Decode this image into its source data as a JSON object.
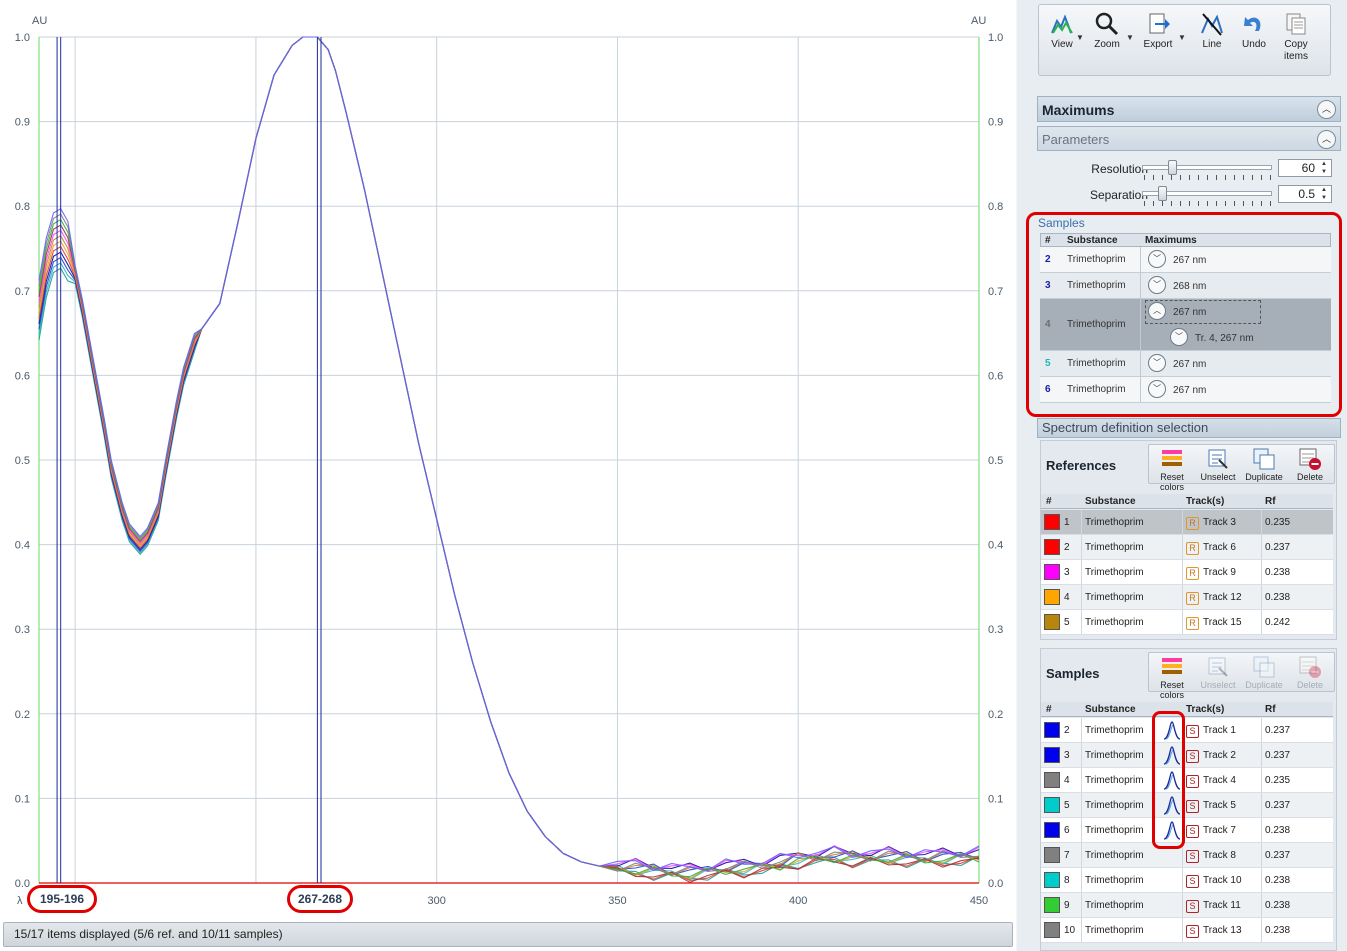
{
  "chart": {
    "y_unit_left": "AU",
    "y_unit_right": "AU",
    "x_axis_symbol": "λ",
    "y_ticks": [
      "0.0",
      "0.1",
      "0.2",
      "0.3",
      "0.4",
      "0.5",
      "0.6",
      "0.7",
      "0.8",
      "0.9",
      "1.0"
    ],
    "x_ticks": [
      "300",
      "350",
      "400",
      "450"
    ],
    "markers": [
      {
        "label": "195-196",
        "x_start": 195,
        "x_end": 196
      },
      {
        "label": "267-268",
        "x_start": 267,
        "x_end": 268
      }
    ],
    "colors": {
      "spectra": [
        "#1f9e8f",
        "#2cb5c4",
        "#2040d8",
        "#1010a0",
        "#e03b3b",
        "#e8a020",
        "#c08a30",
        "#ff40ff",
        "#a03030",
        "#30b040",
        "#808080",
        "#6060ff"
      ],
      "marker_line": "#1a2a9a",
      "axis_green": "#66dd66",
      "baseline_red": "#e00000",
      "grid": "#c8d2dc"
    }
  },
  "chart_data": {
    "type": "line",
    "title": "",
    "xlabel": "λ",
    "ylabel": "AU",
    "xlim": [
      190,
      450
    ],
    "ylim": [
      0,
      1.0
    ],
    "grid": true,
    "series": [
      {
        "x": [
          190,
          192,
          194,
          196,
          198,
          200,
          202,
          205,
          208,
          210,
          213,
          215,
          218,
          220,
          223,
          225,
          228,
          230,
          233,
          235,
          240,
          245,
          250,
          255,
          260,
          263,
          265,
          267,
          270,
          272,
          275,
          280,
          285,
          290,
          295,
          300,
          305,
          310,
          315,
          320,
          325,
          330,
          335,
          340,
          345,
          350,
          355,
          360,
          365,
          370,
          375,
          380,
          385,
          390,
          395,
          400,
          405,
          410,
          415,
          420,
          425,
          430,
          435,
          440,
          445,
          450
        ],
        "y": [
          0.68,
          0.73,
          0.76,
          0.765,
          0.75,
          0.72,
          0.68,
          0.61,
          0.54,
          0.49,
          0.44,
          0.415,
          0.4,
          0.41,
          0.44,
          0.49,
          0.56,
          0.6,
          0.64,
          0.655,
          0.685,
          0.78,
          0.88,
          0.955,
          0.99,
          1.0,
          1.0,
          1.0,
          0.985,
          0.96,
          0.91,
          0.82,
          0.72,
          0.62,
          0.52,
          0.43,
          0.34,
          0.26,
          0.19,
          0.13,
          0.085,
          0.055,
          0.035,
          0.025,
          0.02,
          0.018,
          0.017,
          0.015,
          0.013,
          0.012,
          0.014,
          0.017,
          0.018,
          0.02,
          0.023,
          0.028,
          0.03,
          0.032,
          0.03,
          0.03,
          0.031,
          0.03,
          0.029,
          0.03,
          0.031,
          0.032
        ]
      }
    ]
  },
  "status_bar": "15/17 items displayed (5/6 ref. and 10/11 samples)",
  "toolbar": {
    "buttons": [
      {
        "label": "View",
        "icon": "spectrum-view-icon"
      },
      {
        "label": "Zoom",
        "icon": "magnifier-icon"
      },
      {
        "label": "Export",
        "icon": "export-icon"
      },
      {
        "label": "Line",
        "icon": "line-icon"
      },
      {
        "label": "Undo",
        "icon": "undo-icon"
      },
      {
        "label": "Copy items",
        "icon": "copy-icon"
      }
    ]
  },
  "maximums": {
    "title": "Maximums",
    "parameters_title": "Parameters",
    "resolution": {
      "label": "Resolution",
      "value": "60",
      "slider_fraction": 0.23
    },
    "separation": {
      "label": "Separation",
      "value": "0.5",
      "slider_fraction": 0.15
    },
    "samples_caption": "Samples",
    "headers": [
      "#",
      "Substance",
      "Maximums"
    ],
    "rows": [
      {
        "num": "2",
        "num_color": "#1a1aa8",
        "substance": "Trimethoprim",
        "max": "267 nm",
        "expanded": false
      },
      {
        "num": "3",
        "num_color": "#1a1aa8",
        "substance": "Trimethoprim",
        "max": "268 nm",
        "expanded": false
      },
      {
        "num": "4",
        "num_color": "#6e6e6e",
        "substance": "Trimethoprim",
        "max": "267 nm",
        "expanded": true,
        "child": "Tr. 4, 267 nm"
      },
      {
        "num": "5",
        "num_color": "#20b8b8",
        "substance": "Trimethoprim",
        "max": "267 nm",
        "expanded": false
      },
      {
        "num": "6",
        "num_color": "#1a1aa8",
        "substance": "Trimethoprim",
        "max": "267 nm",
        "expanded": false
      }
    ]
  },
  "spectrum_selection": {
    "title": "Spectrum definition selection",
    "references": {
      "title": "References",
      "buttons": [
        "Reset colors",
        "Unselect",
        "Duplicate",
        "Delete"
      ],
      "headers": [
        "#",
        "Substance",
        "Track(s)",
        "Rf"
      ],
      "rows": [
        {
          "num": "1",
          "color": "#ff0000",
          "substance": "Trimethoprim",
          "badge": "R",
          "track": "Track 3",
          "rf": "0.235"
        },
        {
          "num": "2",
          "color": "#ff0000",
          "substance": "Trimethoprim",
          "badge": "R",
          "track": "Track 6",
          "rf": "0.237"
        },
        {
          "num": "3",
          "color": "#ff00ff",
          "substance": "Trimethoprim",
          "badge": "R",
          "track": "Track 9",
          "rf": "0.238"
        },
        {
          "num": "4",
          "color": "#ffa500",
          "substance": "Trimethoprim",
          "badge": "R",
          "track": "Track 12",
          "rf": "0.238"
        },
        {
          "num": "5",
          "color": "#b8860b",
          "substance": "Trimethoprim",
          "badge": "R",
          "track": "Track 15",
          "rf": "0.242"
        }
      ]
    },
    "samples": {
      "title": "Samples",
      "buttons": [
        "Reset colors",
        "Unselect",
        "Duplicate",
        "Delete"
      ],
      "headers": [
        "#",
        "Substance",
        "Track(s)",
        "Rf"
      ],
      "rows": [
        {
          "num": "2",
          "color": "#0000ee",
          "substance": "Trimethoprim",
          "peak": true,
          "badge": "S",
          "track": "Track 1",
          "rf": "0.237"
        },
        {
          "num": "3",
          "color": "#0000ee",
          "substance": "Trimethoprim",
          "peak": true,
          "badge": "S",
          "track": "Track 2",
          "rf": "0.237"
        },
        {
          "num": "4",
          "color": "#808080",
          "substance": "Trimethoprim",
          "peak": true,
          "badge": "S",
          "track": "Track 4",
          "rf": "0.235"
        },
        {
          "num": "5",
          "color": "#00cccc",
          "substance": "Trimethoprim",
          "peak": true,
          "badge": "S",
          "track": "Track 5",
          "rf": "0.237"
        },
        {
          "num": "6",
          "color": "#0000ee",
          "substance": "Trimethoprim",
          "peak": true,
          "badge": "S",
          "track": "Track 7",
          "rf": "0.238"
        },
        {
          "num": "7",
          "color": "#808080",
          "substance": "Trimethoprim",
          "peak": false,
          "badge": "S",
          "track": "Track 8",
          "rf": "0.237"
        },
        {
          "num": "8",
          "color": "#00cccc",
          "substance": "Trimethoprim",
          "peak": false,
          "badge": "S",
          "track": "Track 10",
          "rf": "0.238"
        },
        {
          "num": "9",
          "color": "#33cc33",
          "substance": "Trimethoprim",
          "peak": false,
          "badge": "S",
          "track": "Track 11",
          "rf": "0.238"
        },
        {
          "num": "10",
          "color": "#808080",
          "substance": "Trimethoprim",
          "peak": false,
          "badge": "S",
          "track": "Track 13",
          "rf": "0.238"
        }
      ]
    }
  }
}
